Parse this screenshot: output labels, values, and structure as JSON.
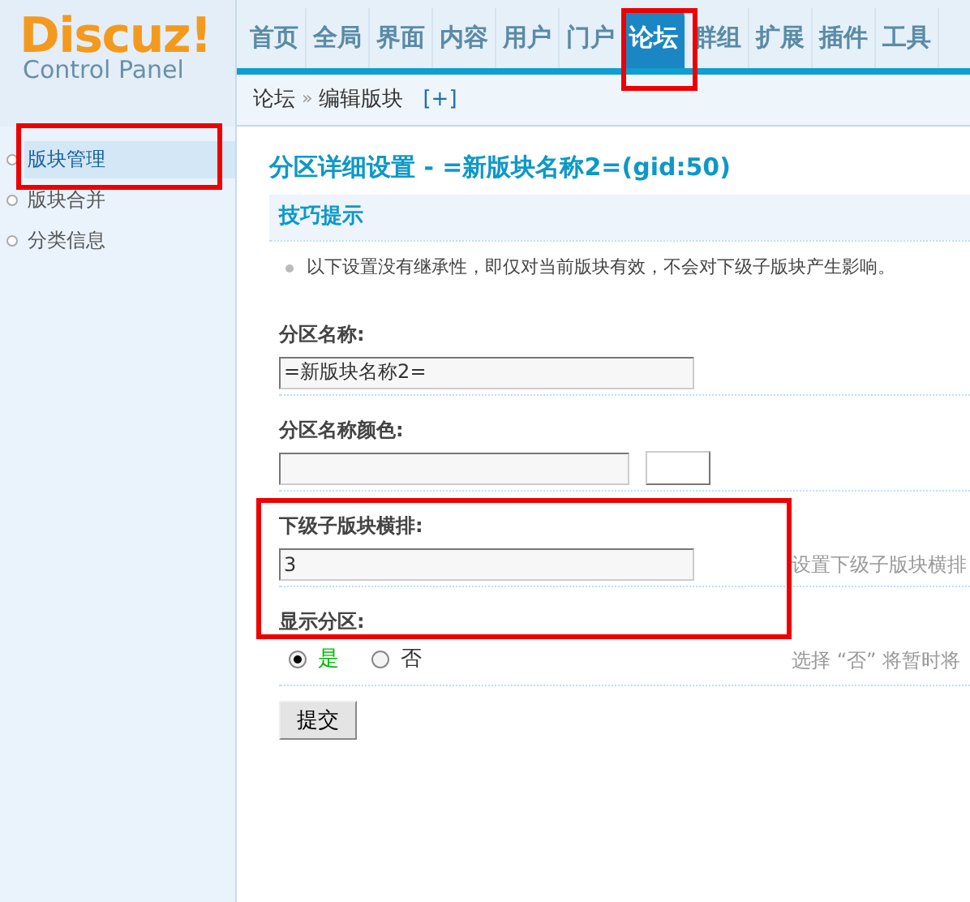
{
  "logo": {
    "brand": "Discuz",
    "mark": "!",
    "subtitle": "Control Panel"
  },
  "nav": [
    {
      "label": "首页",
      "selected": false
    },
    {
      "label": "全局",
      "selected": false
    },
    {
      "label": "界面",
      "selected": false
    },
    {
      "label": "内容",
      "selected": false
    },
    {
      "label": "用户",
      "selected": false
    },
    {
      "label": "门户",
      "selected": false
    },
    {
      "label": "论坛",
      "selected": true
    },
    {
      "label": "群组",
      "selected": false
    },
    {
      "label": "扩展",
      "selected": false
    },
    {
      "label": "插件",
      "selected": false
    },
    {
      "label": "工具",
      "selected": false
    }
  ],
  "breadcrumb": {
    "parent": "论坛",
    "separator": "»",
    "current": "编辑版块",
    "toggle": "[+]"
  },
  "sidebar": {
    "items": [
      {
        "label": "版块管理",
        "selected": true
      },
      {
        "label": "版块合并",
        "selected": false
      },
      {
        "label": "分类信息",
        "selected": false
      }
    ]
  },
  "title": "分区详细设置 - =新版块名称2=(gid:50)",
  "tips": {
    "heading": "技巧提示",
    "items": [
      "以下设置没有继承性，即仅对当前版块有效，不会对下级子版块产生影响。"
    ]
  },
  "fields": [
    {
      "kind": "text",
      "label": "分区名称:",
      "value": "=新版块名称2="
    },
    {
      "kind": "color",
      "label": "分区名称颜色:"
    },
    {
      "kind": "text",
      "label": "下级子版块横排:",
      "value": "3",
      "hint": "设置下级子版块横排"
    },
    {
      "kind": "radio",
      "label": "显示分区:",
      "options": [
        {
          "label": "是",
          "selected": true
        },
        {
          "label": "否",
          "selected": false
        }
      ],
      "hint": "选择 “否” 将暂时将"
    }
  ],
  "submit": "提交"
}
